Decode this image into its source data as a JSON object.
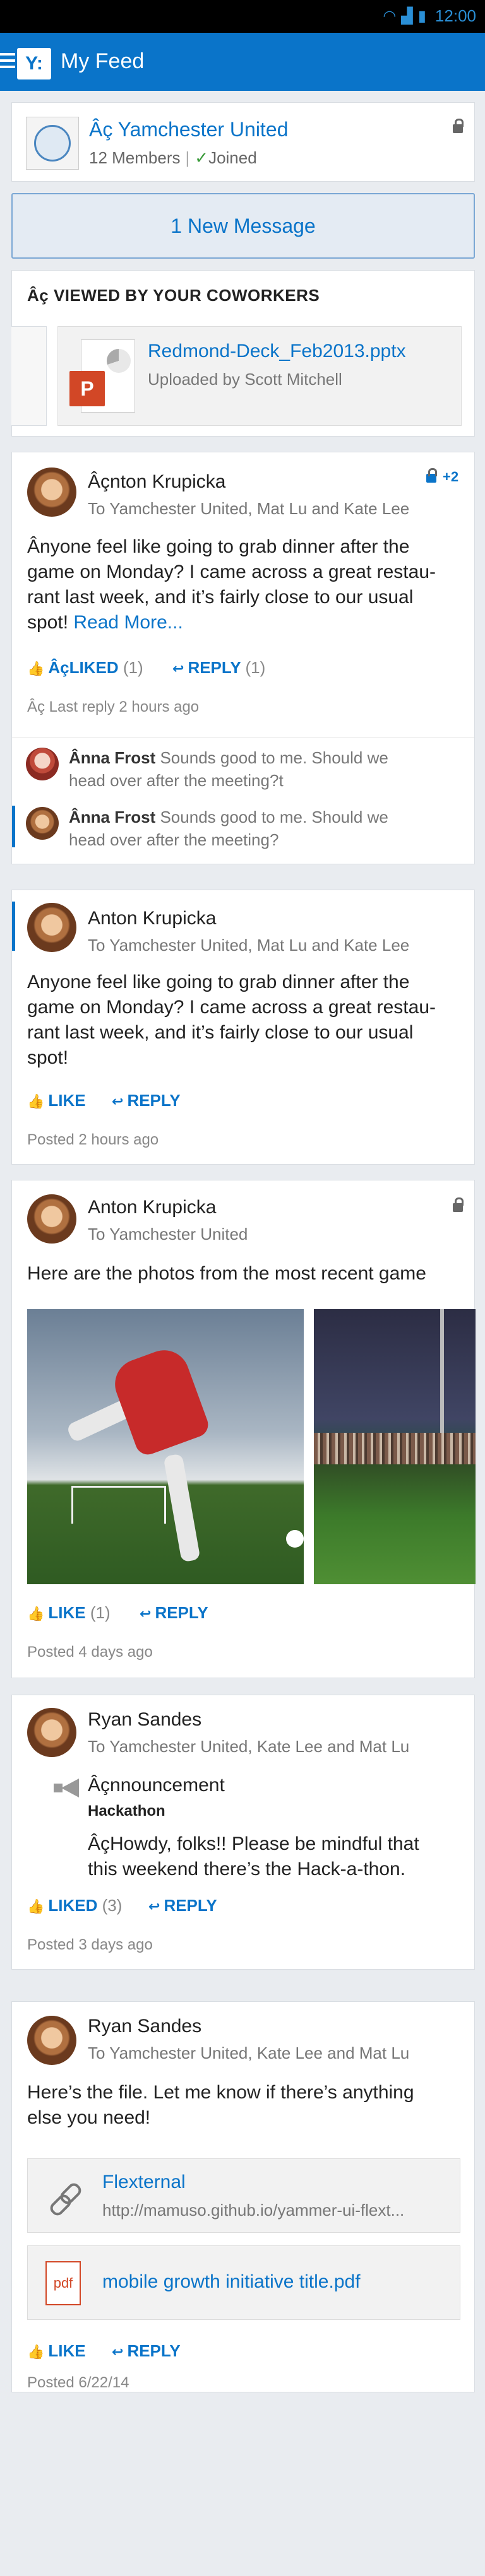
{
  "status_bar": {
    "time": "12:00",
    "wifi_icon": "wifi-icon",
    "signal_icon": "signal-icon",
    "battery_icon": "battery-icon"
  },
  "app_bar": {
    "logo": "Y:",
    "title": "My Feed"
  },
  "group": {
    "name": "Âç Yamchester United",
    "members": "12 Members",
    "joined": "Joined"
  },
  "new_message": "1 New Message",
  "viewed": {
    "title": "Âç VIEWED BY YOUR COWORKERS",
    "file_name": "Redmond-Deck_Feb2013.pptx",
    "file_meta": "Uploaded by Scott Mitchell",
    "file_badge": "P"
  },
  "posts": [
    {
      "author": "Âçnton Krupicka",
      "recipients": "To Yamchester United, Mat Lu and Kate Lee",
      "privacy_count": "+2",
      "body_lines": [
        "Ânyone feel like going to grab dinner after the",
        "game on Monday? I came across a great restau-",
        "rant last week, and it’s fairly close to our usual"
      ],
      "body_last": "spot!",
      "read_more": "Read More...",
      "like_label": "ÂçLIKED",
      "like_count": "(1)",
      "reply_label": "REPLY",
      "reply_count": "(1)",
      "meta": "Âç Last reply 2 hours ago",
      "replies": [
        {
          "author": "Ânna Frost",
          "text_line1": "Sounds good to me. Should we",
          "text_line2": "head over after the meeting?t"
        },
        {
          "author": "Ânna Frost",
          "text_line1": "Sounds good to me. Should we",
          "text_line2": "head over after the meeting?"
        }
      ]
    },
    {
      "author": "Anton Krupicka",
      "recipients": "To Yamchester United, Mat Lu and Kate Lee",
      "body_lines": [
        "Anyone feel like going to grab dinner after the",
        "game on Monday? I came across a great restau-",
        "rant last week, and it’s fairly close to our usual",
        "spot!"
      ],
      "like_label": "LIKE",
      "reply_label": "REPLY",
      "meta": "Posted 2 hours ago"
    },
    {
      "author": "Anton Krupicka",
      "recipients": "To Yamchester United",
      "body": "Here are the photos from the most recent game",
      "like_label": "LIKE",
      "like_count": "(1)",
      "reply_label": "REPLY",
      "meta": "Posted 4 days ago"
    },
    {
      "author": "Ryan Sandes",
      "recipients": "To Yamchester United, Kate Lee and Mat Lu",
      "announcement_title": "Âçnnouncement",
      "announcement_subtitle": "Hackathon",
      "announcement_line1": "ÂçHowdy, folks!!  Please be mindful that",
      "announcement_line2": "this weekend there’s the Hack-a-thon.",
      "like_label": "LIKED",
      "like_count": "(3)",
      "reply_label": "REPLY",
      "meta": "Posted 3 days ago"
    },
    {
      "author": "Ryan Sandes",
      "recipients": "To Yamchester United, Kate Lee and Mat Lu",
      "body_line1": "Here’s the file. Let me know if there’s anything",
      "body_line2": "else you need!",
      "link_title": "Flexternal",
      "link_url": "http://mamuso.github.io/yammer-ui-flext...",
      "pdf_badge": "pdf",
      "pdf_name": "mobile growth initiative title.pdf",
      "like_label": "LIKE",
      "reply_label": "REPLY",
      "meta": "Posted 6/22/14"
    }
  ]
}
